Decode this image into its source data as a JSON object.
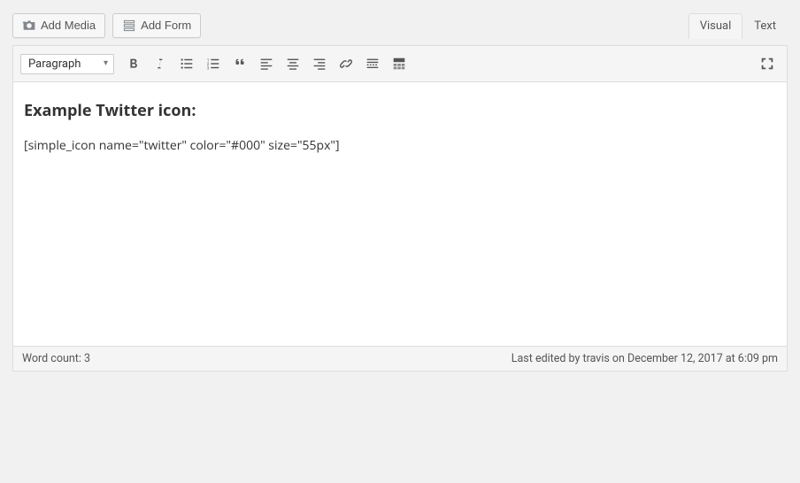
{
  "buttons": {
    "add_media": "Add Media",
    "add_form": "Add Form"
  },
  "tabs": {
    "visual": "Visual",
    "text": "Text"
  },
  "format_select": "Paragraph",
  "content": {
    "heading": "Example Twitter icon:",
    "body": "[simple_icon name=\"twitter\" color=\"#000\" size=\"55px\"]"
  },
  "status": {
    "word_count": "Word count: 3",
    "last_edited": "Last edited by travis on December 12, 2017 at 6:09 pm"
  }
}
